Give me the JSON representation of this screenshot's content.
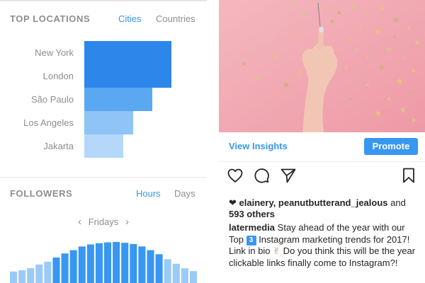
{
  "top_locations": {
    "title": "TOP LOCATIONS",
    "tabs": {
      "cities": "Cities",
      "countries": "Countries"
    },
    "active_tab": "Cities",
    "rows": [
      {
        "label": "New York",
        "value": 1.0,
        "color": "#2d87ea"
      },
      {
        "label": "London",
        "value": 1.0,
        "color": "#2d87ea"
      },
      {
        "label": "São Paulo",
        "value": 0.78,
        "color": "#5aa8f2"
      },
      {
        "label": "Los Angeles",
        "value": 0.56,
        "color": "#8ec4f6"
      },
      {
        "label": "Jakarta",
        "value": 0.45,
        "color": "#b3d8fa"
      }
    ]
  },
  "followers": {
    "title": "FOLLOWERS",
    "tabs": {
      "hours": "Hours",
      "days": "Days"
    },
    "active_tab": "Hours",
    "day_label": "Fridays",
    "bars": [
      0.28,
      0.31,
      0.36,
      0.45,
      0.52,
      0.62,
      0.72,
      0.8,
      0.89,
      0.94,
      0.97,
      0.99,
      1.0,
      0.98,
      0.95,
      0.89,
      0.8,
      0.7,
      0.58,
      0.47,
      0.36,
      0.29
    ],
    "bar_colors": {
      "strong": "#3897f0",
      "light": "#9bcaf6"
    }
  },
  "post": {
    "view_insights": "View Insights",
    "promote": "Promote",
    "liked_by": "elainery, peanutbutterand_jealous",
    "and_word": " and",
    "others": "593 others",
    "caption_user": "latermedia",
    "caption_pre": " Stay ahead of the year with our Top ",
    "caption_badge": "3",
    "caption_post": " Instagram marketing trends for 2017! Link in bio ",
    "caption_end": " Do you think this will be the year clickable links finally come to Instagram?!",
    "icons": [
      "heart-icon",
      "comment-icon",
      "share-icon",
      "bookmark-icon"
    ]
  }
}
